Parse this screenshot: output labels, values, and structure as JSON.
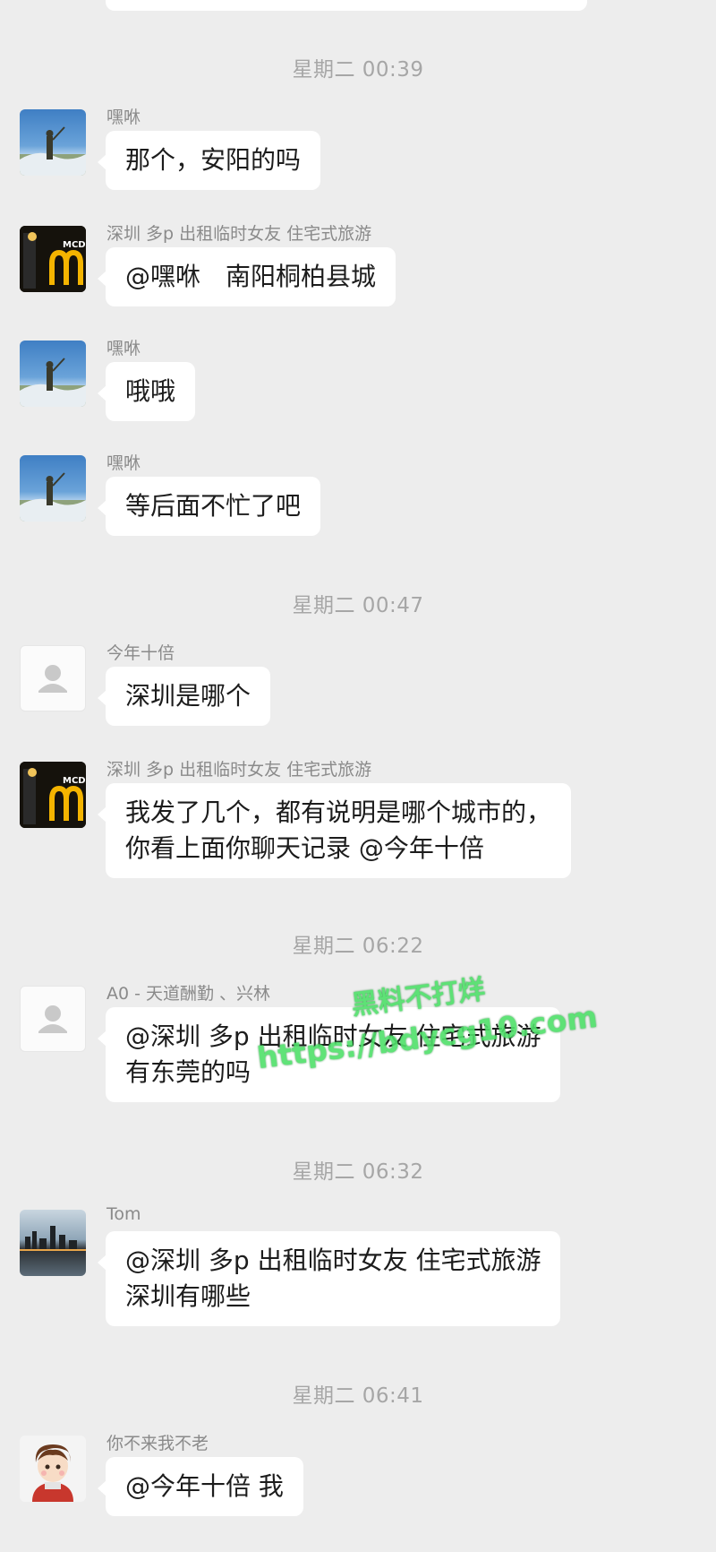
{
  "timestamps": [
    "星期二 00:39",
    "星期二 00:47",
    "星期二 06:22",
    "星期二 06:32",
    "星期二 06:41"
  ],
  "messages": [
    {
      "sender": "嘿咻",
      "avatar": "landscape-avatar",
      "lines": [
        "那个，安阳的吗"
      ]
    },
    {
      "sender": "深圳 多p 出租临时女友 住宅式旅游",
      "avatar": "mcdonalds-avatar",
      "lines": [
        "@嘿咻　南阳桐柏县城"
      ]
    },
    {
      "sender": "嘿咻",
      "avatar": "landscape-avatar",
      "lines": [
        "哦哦"
      ]
    },
    {
      "sender": "嘿咻",
      "avatar": "landscape-avatar",
      "lines": [
        "等后面不忙了吧"
      ]
    },
    {
      "sender": "今年十倍",
      "avatar": "default-avatar",
      "lines": [
        "深圳是哪个"
      ]
    },
    {
      "sender": "深圳 多p 出租临时女友 住宅式旅游",
      "avatar": "mcdonalds-avatar",
      "lines": [
        "我发了几个，都有说明是哪个城市的，",
        "你看上面你聊天记录 @今年十倍"
      ]
    },
    {
      "sender": "A0 - 天道酬勤 、兴林",
      "avatar": "default-avatar",
      "lines": [
        "@深圳 多p 出租临时女友 住宅式旅游",
        "有东莞的吗"
      ]
    },
    {
      "sender": "Tom",
      "avatar": "city-avatar",
      "lines": [
        "@深圳 多p 出租临时女友 住宅式旅游",
        "深圳有哪些"
      ]
    },
    {
      "sender": "你不来我不老",
      "avatar": "cartoon-avatar",
      "lines": [
        "@今年十倍 我"
      ]
    }
  ],
  "watermark": {
    "line1": "黑料不打烊",
    "line2": "https://bdycg10.com",
    "color": "#4fe06a"
  },
  "logo_text": "MCD"
}
